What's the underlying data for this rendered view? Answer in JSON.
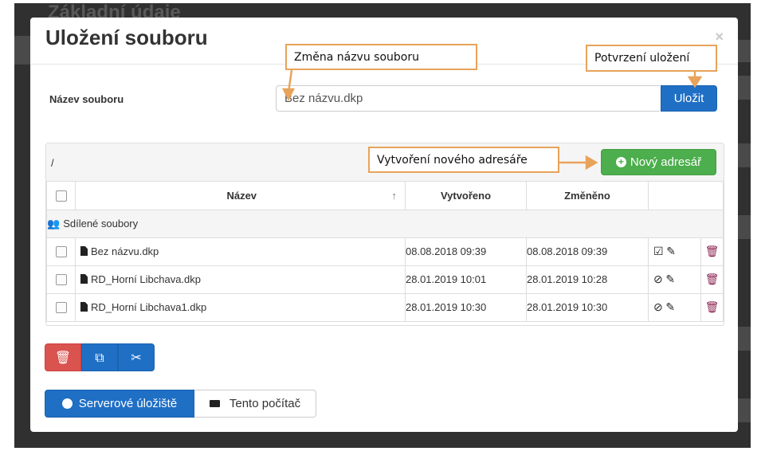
{
  "backdrop": {
    "title": "Základní údaje"
  },
  "dialog": {
    "title": "Uložení souboru",
    "close": "×",
    "filename_label": "Název souboru",
    "filename_value": "Bez názvu.dkp",
    "save_label": "Uložit"
  },
  "browser": {
    "path": "/",
    "new_folder_label": "Nový adresář",
    "columns": {
      "name": "Název",
      "created": "Vytvořeno",
      "modified": "Změněno"
    },
    "sort_arrow": "↑",
    "shared_label": "Sdílené soubory",
    "rows": [
      {
        "name": "Bez názvu.dkp",
        "created": "08.08.2018 09:39",
        "modified": "08.08.2018 09:39",
        "status": "☑"
      },
      {
        "name": "RD_Horní Libchava.dkp",
        "created": "28.01.2019 10:01",
        "modified": "28.01.2019 10:28",
        "status": "⊘"
      },
      {
        "name": "RD_Horní Libchava1.dkp",
        "created": "28.01.2019 10:30",
        "modified": "28.01.2019 10:30",
        "status": "⊘"
      }
    ],
    "edit_glyph": "✎",
    "trash_glyph": "🗑"
  },
  "actions": {
    "delete": "🗑",
    "copy": "⧉",
    "cut": "✂"
  },
  "storage": {
    "server_label": "Serverové úložiště",
    "local_label": "Tento počítač"
  },
  "annotations": {
    "rename": "Změna názvu souboru",
    "confirm": "Potvrzení uložení",
    "new_folder": "Vytvoření nového adresáře"
  },
  "colors": {
    "accent": "#e8a35a",
    "primary": "#1f6fc5",
    "success": "#4cae4c",
    "danger": "#d9534f"
  }
}
